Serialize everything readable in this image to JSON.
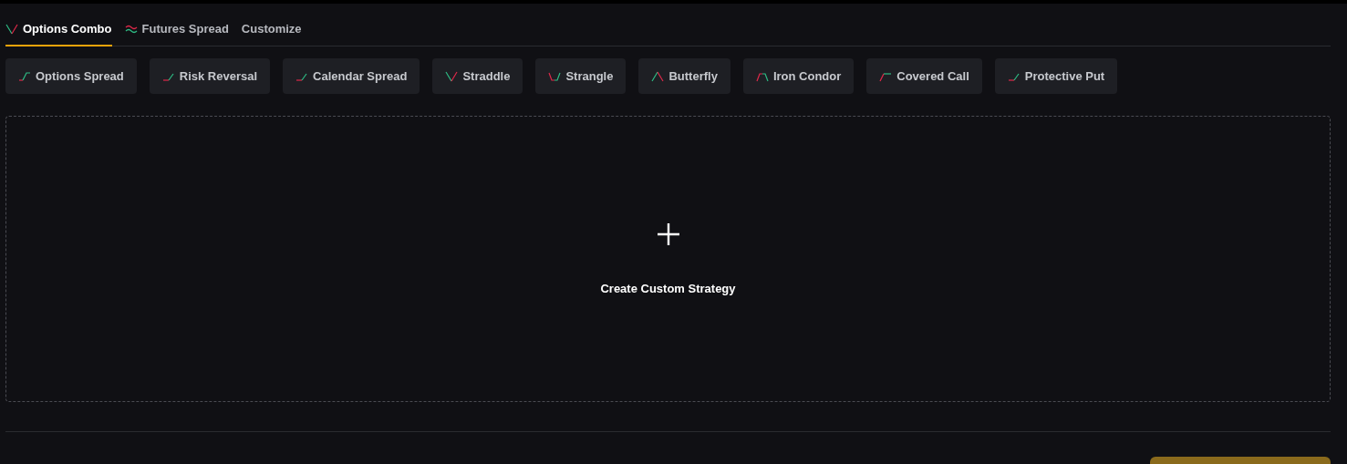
{
  "tabs": [
    {
      "label": "Options Combo",
      "kind": "v",
      "selected": true
    },
    {
      "label": "Futures Spread",
      "kind": "waves",
      "selected": false
    },
    {
      "label": "Customize",
      "selected": false
    }
  ],
  "strategies": [
    {
      "label": "Options Spread",
      "kind": "bull"
    },
    {
      "label": "Risk Reversal",
      "kind": "rise"
    },
    {
      "label": "Calendar Spread",
      "kind": "rise"
    },
    {
      "label": "Straddle",
      "kind": "v"
    },
    {
      "label": "Strangle",
      "kind": "u"
    },
    {
      "label": "Butterfly",
      "kind": "peak"
    },
    {
      "label": "Iron Condor",
      "kind": "plateau"
    },
    {
      "label": "Covered Call",
      "kind": "call"
    },
    {
      "label": "Protective Put",
      "kind": "rise"
    }
  ],
  "custom": {
    "label": "Create Custom Strategy"
  }
}
